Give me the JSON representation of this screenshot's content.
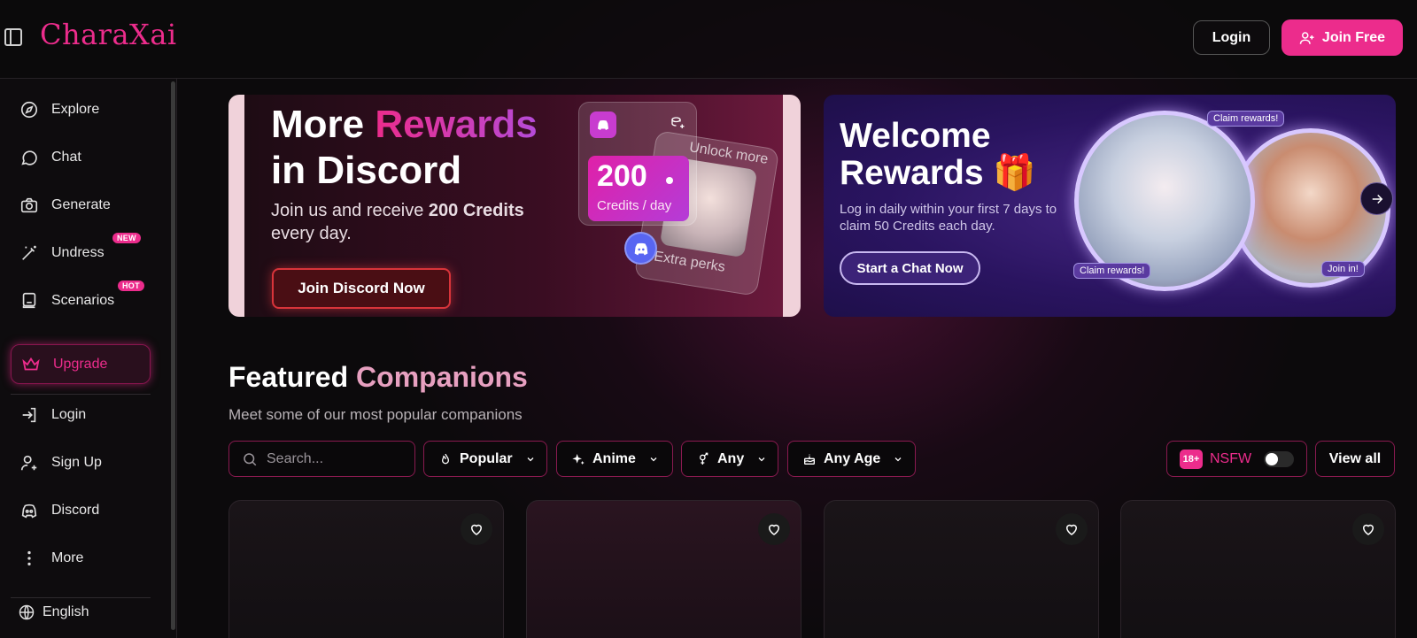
{
  "header": {
    "logo": "CharaXai",
    "login_label": "Login",
    "join_label": "Join Free"
  },
  "sidebar": {
    "items": [
      {
        "label": "Explore",
        "icon": "compass-icon"
      },
      {
        "label": "Chat",
        "icon": "chat-bubble-icon"
      },
      {
        "label": "Generate",
        "icon": "camera-icon"
      },
      {
        "label": "Undress",
        "icon": "magic-wand-icon",
        "badge": "NEW"
      },
      {
        "label": "Scenarios",
        "icon": "scenario-book-icon",
        "badge": "HOT"
      }
    ],
    "upgrade_label": "Upgrade",
    "account_items": [
      {
        "label": "Login",
        "icon": "login-icon"
      },
      {
        "label": "Sign Up",
        "icon": "user-plus-icon"
      },
      {
        "label": "Discord",
        "icon": "discord-icon"
      },
      {
        "label": "More",
        "icon": "more-vertical-icon"
      }
    ],
    "language": "English"
  },
  "banners": {
    "discord": {
      "title_line1_plain": "More ",
      "title_line1_accent": "Rewards",
      "title_line2": "in Discord",
      "subtitle_plain": "Join us and receive ",
      "subtitle_bold": "200 Credits",
      "subtitle_end": " every day.",
      "button_label": "Join Discord Now",
      "credits_value": "200",
      "credits_unit": "Credits / day",
      "unlock_text": "Unlock more",
      "extra_text": "Extra perks"
    },
    "welcome": {
      "title_line1": "Welcome",
      "title_line2": "Rewards",
      "subtitle": "Log in daily within your first 7 days to claim 50 Credits each day.",
      "button_label": "Start a Chat Now",
      "tag_claim_top": "Claim rewards!",
      "tag_claim_bottom": "Claim rewards!",
      "tag_join": "Join in!"
    }
  },
  "featured": {
    "title_plain": "Featured ",
    "title_accent": "Companions",
    "subtitle": "Meet some of our most popular companions",
    "search_placeholder": "Search...",
    "filters": [
      {
        "label": "Popular",
        "icon": "flame-icon"
      },
      {
        "label": "Anime",
        "icon": "sparkle-icon"
      },
      {
        "label": "Any",
        "icon": "gender-icon"
      },
      {
        "label": "Any Age",
        "icon": "cake-icon"
      }
    ],
    "nsfw_badge": "18+",
    "nsfw_label": "NSFW",
    "nsfw_enabled": false,
    "view_all_label": "View all"
  },
  "colors": {
    "accent": "#ec2c8c",
    "background": "#0c0a0c"
  }
}
